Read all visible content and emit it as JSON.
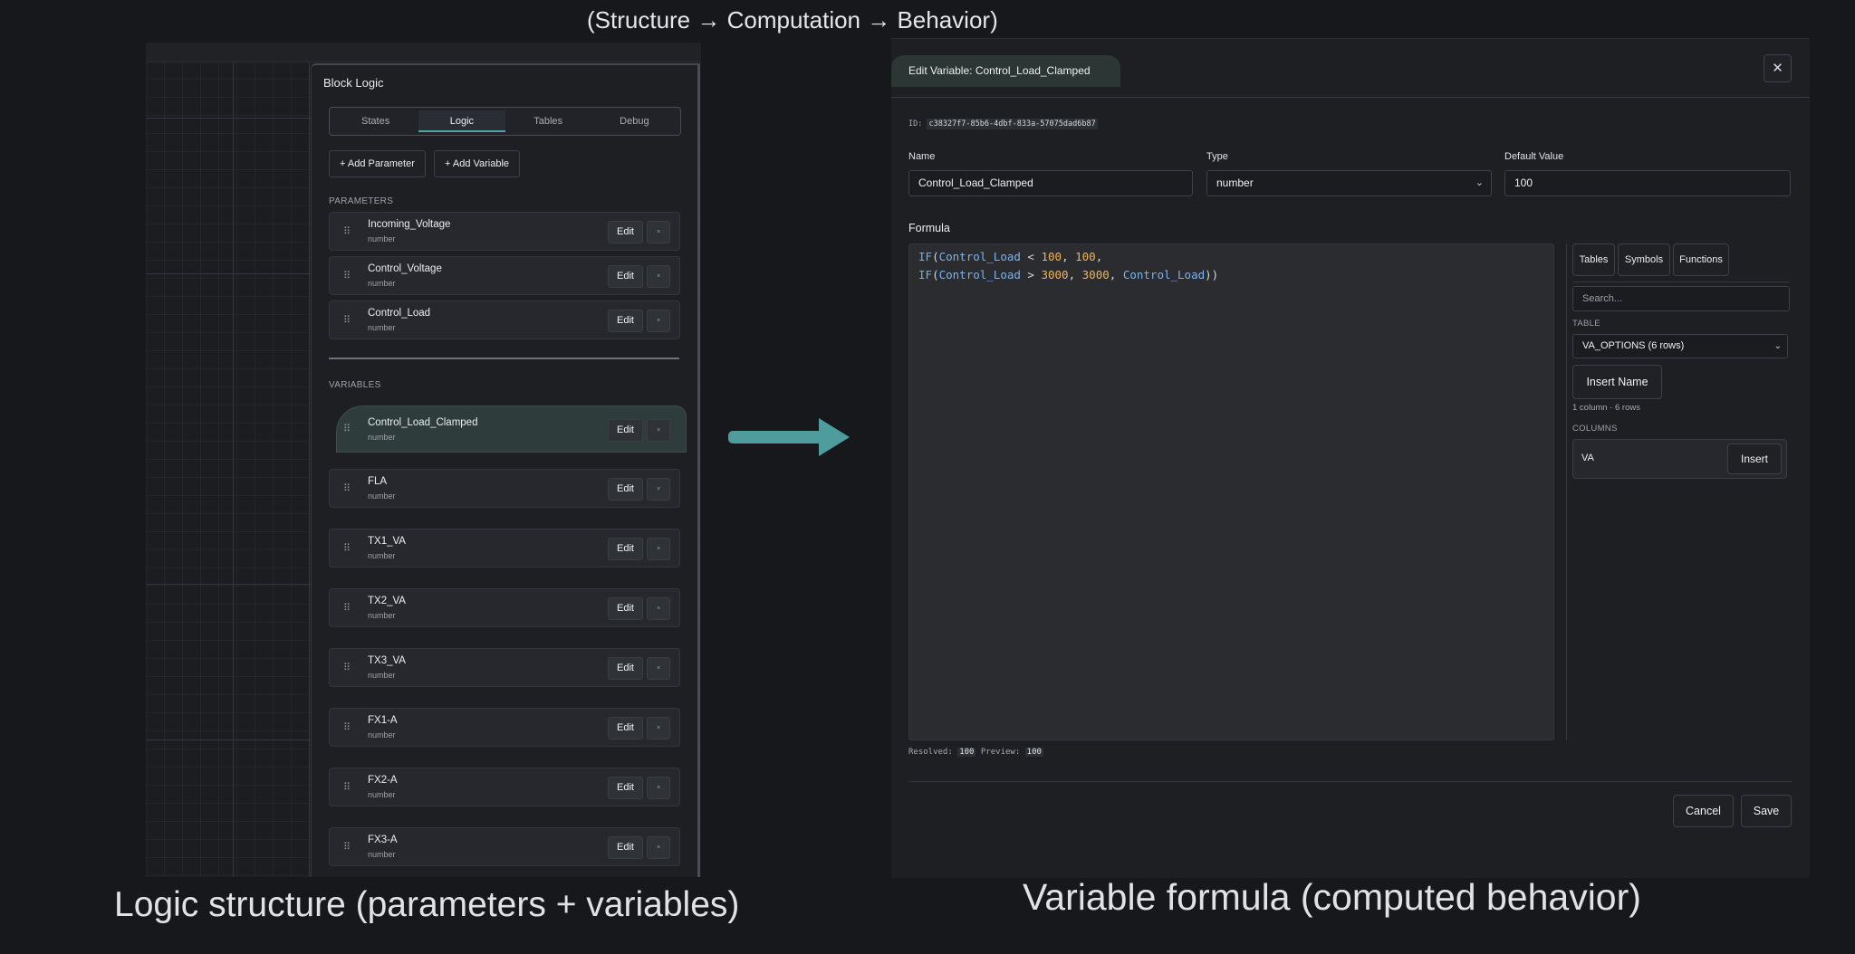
{
  "captions": {
    "top": "(Structure → Computation → Behavior)",
    "left": "Logic structure (parameters + variables)",
    "right": "Variable formula (computed behavior)"
  },
  "panel": {
    "title": "Block Logic",
    "tabs": [
      {
        "label": "States",
        "active": false
      },
      {
        "label": "Logic",
        "active": true
      },
      {
        "label": "Tables",
        "active": false
      },
      {
        "label": "Debug",
        "active": false
      }
    ],
    "add_parameter": "+ Add Parameter",
    "add_variable": "+ Add Variable",
    "parameters_label": "PARAMETERS",
    "variables_label": "VARIABLES",
    "edit_label": "Edit",
    "remove_label": "×",
    "parameters": [
      {
        "name": "Incoming_Voltage",
        "type": "number"
      },
      {
        "name": "Control_Voltage",
        "type": "number"
      },
      {
        "name": "Control_Load",
        "type": "number"
      }
    ],
    "variables": [
      {
        "name": "Control_Load_Clamped",
        "type": "number",
        "selected": true
      },
      {
        "name": "FLA",
        "type": "number"
      },
      {
        "name": "TX1_VA",
        "type": "number"
      },
      {
        "name": "TX2_VA",
        "type": "number"
      },
      {
        "name": "TX3_VA",
        "type": "number"
      },
      {
        "name": "FX1-A",
        "type": "number"
      },
      {
        "name": "FX2-A",
        "type": "number"
      },
      {
        "name": "FX3-A",
        "type": "number"
      }
    ]
  },
  "dialog": {
    "title": "Edit Variable: Control_Load_Clamped",
    "close": "✕",
    "id_label": "ID:",
    "id_value": "c38327f7-85b6-4dbf-833a-57075dad6b87",
    "name_label": "Name",
    "name_value": "Control_Load_Clamped",
    "type_label": "Type",
    "type_value": "number",
    "default_label": "Default Value",
    "default_value": "100",
    "formula_label": "Formula",
    "side_tabs": [
      "Tables",
      "Symbols",
      "Functions"
    ],
    "search_placeholder": "Search...",
    "table_label": "TABLE",
    "table_value": "VA_OPTIONS (6 rows)",
    "insert_name": "Insert Name",
    "table_meta": "1 column · 6 rows",
    "columns_label": "COLUMNS",
    "column_name": "VA",
    "insert_label": "Insert",
    "resolved_label": "Resolved:",
    "resolved_value": "100",
    "preview_label": "Preview:",
    "preview_value": "100",
    "cancel": "Cancel",
    "save": "Save"
  },
  "colors": {
    "accent": "#4fa3a0",
    "arrow": "#4e9c9c",
    "background": "#16181c"
  }
}
